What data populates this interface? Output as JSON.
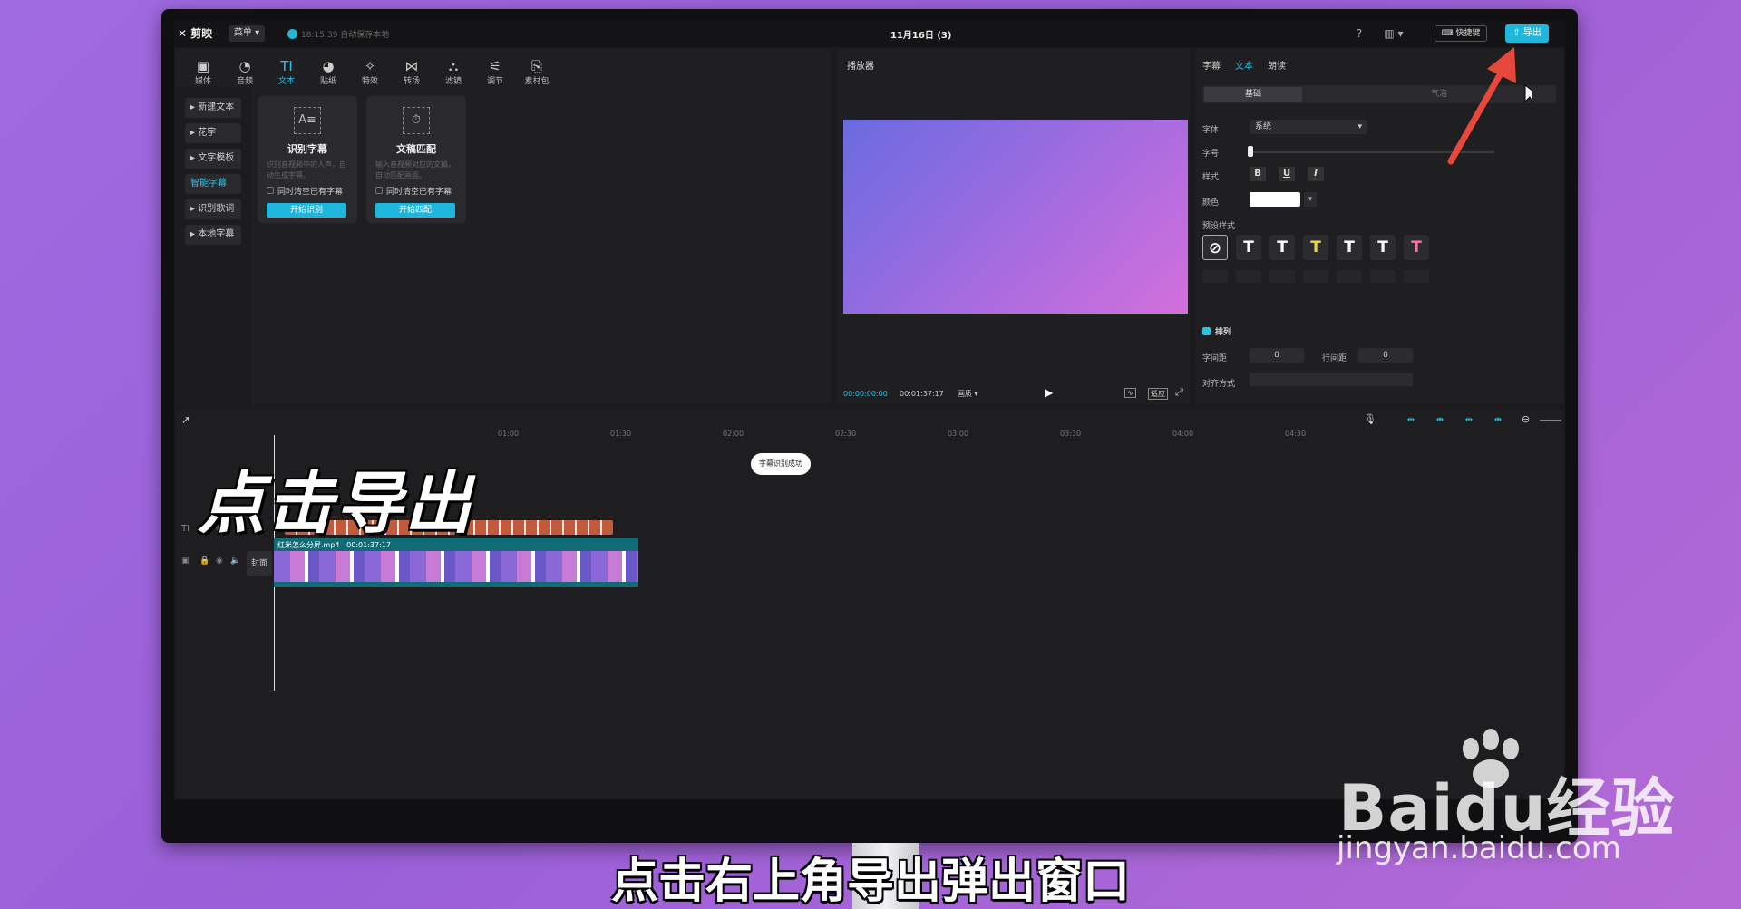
{
  "app": {
    "logo": "剪映",
    "menu_label": "菜单",
    "autosave": "18:15:39 自动保存本地",
    "project_title": "11月16日 (3)",
    "shortcut_label": "快捷键",
    "export_label": "导出"
  },
  "library": {
    "tabs": [
      {
        "label": "媒体",
        "icon": "media-icon",
        "glyph": "▣"
      },
      {
        "label": "音频",
        "icon": "audio-icon",
        "glyph": "◔"
      },
      {
        "label": "文本",
        "icon": "text-icon",
        "glyph": "TI"
      },
      {
        "label": "贴纸",
        "icon": "sticker-icon",
        "glyph": "◕"
      },
      {
        "label": "特效",
        "icon": "effects-icon",
        "glyph": "✧"
      },
      {
        "label": "转场",
        "icon": "transition-icon",
        "glyph": "⋈"
      },
      {
        "label": "滤镜",
        "icon": "filter-icon",
        "glyph": "⛬"
      },
      {
        "label": "调节",
        "icon": "adjust-icon",
        "glyph": "⚟"
      },
      {
        "label": "素材包",
        "icon": "package-icon",
        "glyph": "⎘"
      }
    ],
    "active_tab": "文本",
    "sidebar": [
      "新建文本",
      "花字",
      "文字模板",
      "智能字幕",
      "识别歌词",
      "本地字幕"
    ],
    "active_sidebar": "智能字幕",
    "cards": [
      {
        "title": "识别字幕",
        "desc": "识别音视频中的人声，自动生成字幕。",
        "check": "同时清空已有字幕",
        "button": "开始识别",
        "icon_text": "A≡"
      },
      {
        "title": "文稿匹配",
        "desc": "输入音视频对应的文稿，自动匹配画面。",
        "check": "同时清空已有字幕",
        "button": "开始匹配",
        "icon_text": "⏱"
      }
    ]
  },
  "player": {
    "title": "播放器",
    "current_time": "00:00:00:00",
    "total_time": "00:01:37:17",
    "quality": "画质",
    "ratio_btn": "适应"
  },
  "inspector": {
    "tabs": [
      "字幕",
      "文本",
      "朗读"
    ],
    "active_tab": "文本",
    "segments": [
      "基础",
      "气泡"
    ],
    "font_label": "字体",
    "font_value": "系统",
    "size_label": "字号",
    "style_label": "样式",
    "style_buttons": [
      "B",
      "U",
      "I"
    ],
    "color_label": "颜色",
    "color_value": "#ffffff",
    "preset_label": "预设样式",
    "presets": [
      {
        "glyph": "⊘",
        "color": "#ffffff"
      },
      {
        "glyph": "T",
        "color": "#ffffff"
      },
      {
        "glyph": "T",
        "color": "#ffffff"
      },
      {
        "glyph": "T",
        "color": "#f2d43a"
      },
      {
        "glyph": "T",
        "color": "#ffffff"
      },
      {
        "glyph": "T",
        "color": "#ffffff"
      },
      {
        "glyph": "T",
        "color": "#ff6fa8"
      }
    ],
    "arrange_label": "排列",
    "char_spacing_label": "字间距",
    "char_spacing_value": "0",
    "line_spacing_label": "行间距",
    "line_spacing_value": "0",
    "align_label": "对齐方式"
  },
  "timeline": {
    "ticks": [
      "01:00",
      "01:30",
      "02:00",
      "02:30",
      "03:00",
      "03:30",
      "04:00",
      "04:30"
    ],
    "toast": "字幕识别成功",
    "clip_name": "红米怎么分屏.mp4",
    "clip_duration": "00:01:37:17",
    "cover_label": "封面",
    "text_track_icon": "TI"
  },
  "overlay": {
    "big_caption": "点击导出",
    "subtitle": "点击右上角导出弹出窗口",
    "watermark_brand": "Baidu经验",
    "watermark_domain": "jingyan.baidu.com",
    "accent": "#1fb6de",
    "arrow_color": "#e8473b"
  }
}
